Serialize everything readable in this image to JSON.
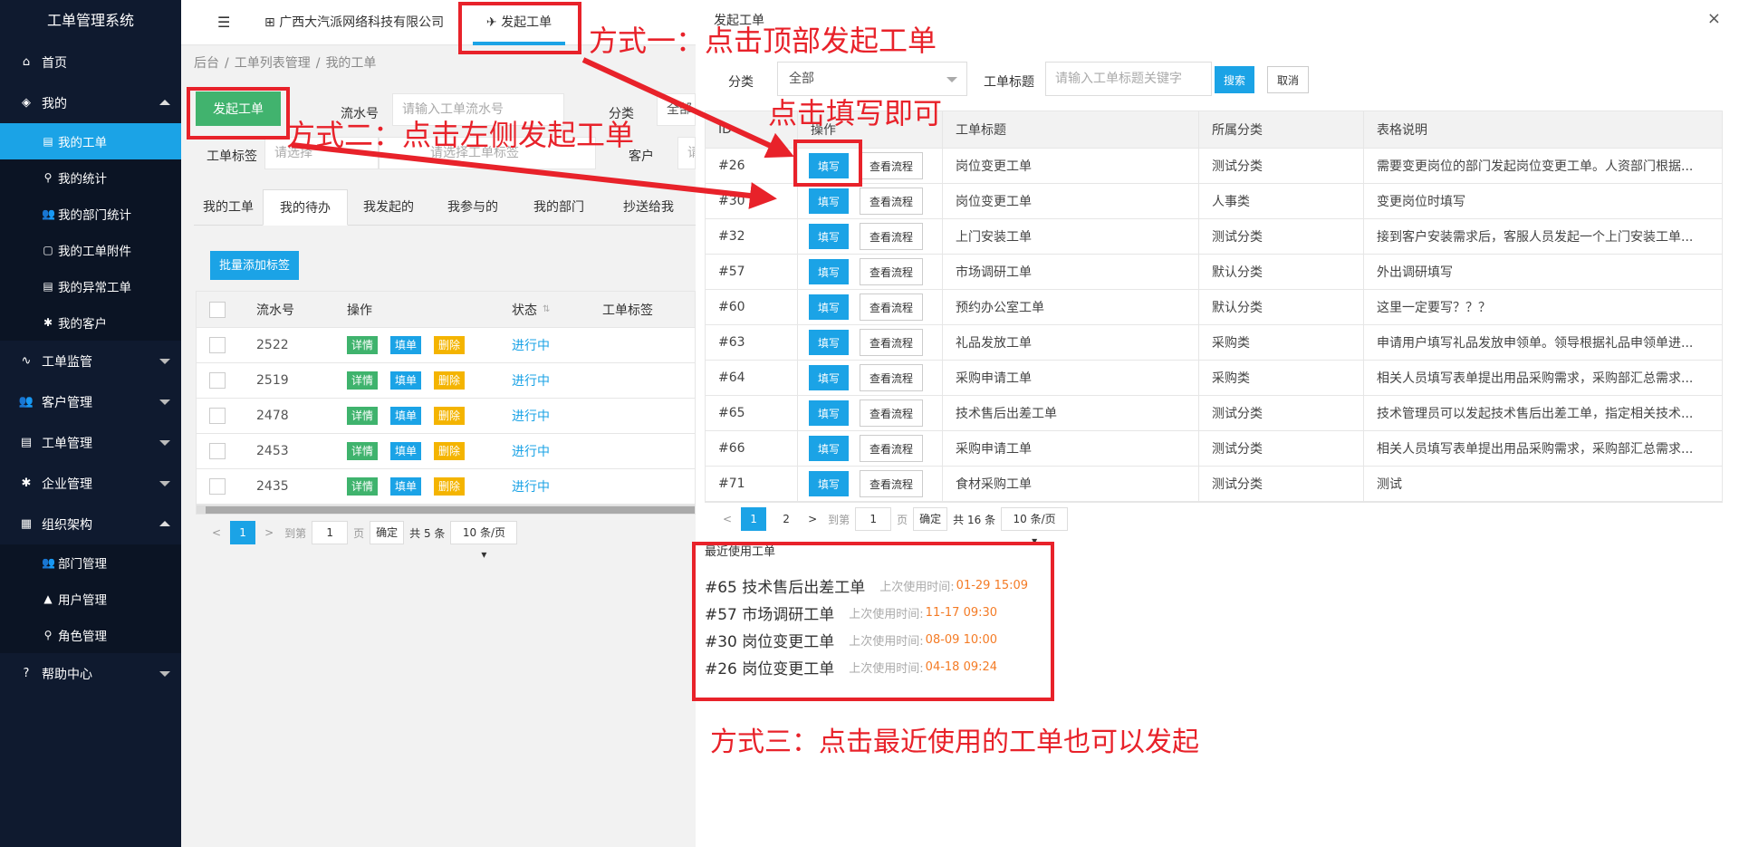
{
  "sidebar": {
    "brand": "工单管理系统",
    "items": [
      {
        "label": "首页",
        "icon": "⌂"
      },
      {
        "label": "我的",
        "icon": "◈"
      },
      {
        "label": "工单监管",
        "icon": "∿"
      },
      {
        "label": "客户管理",
        "icon": "👥"
      },
      {
        "label": "工单管理",
        "icon": "▤"
      },
      {
        "label": "企业管理",
        "icon": "✱"
      },
      {
        "label": "组织架构",
        "icon": "▦"
      },
      {
        "label": "帮助中心",
        "icon": "?"
      }
    ],
    "my_sub": [
      {
        "label": "我的工单",
        "icon": "▤"
      },
      {
        "label": "我的统计",
        "icon": "⚲"
      },
      {
        "label": "我的部门统计",
        "icon": "👥"
      },
      {
        "label": "我的工单附件",
        "icon": "▢"
      },
      {
        "label": "我的异常工单",
        "icon": "▤"
      },
      {
        "label": "我的客户",
        "icon": "✱"
      }
    ],
    "org_sub": [
      {
        "label": "部门管理",
        "icon": "👥"
      },
      {
        "label": "用户管理",
        "icon": "▲"
      },
      {
        "label": "角色管理",
        "icon": "⚲"
      }
    ]
  },
  "topbar": {
    "hamburger_icon": "☰",
    "company": "广西大汽派网络科技有限公司",
    "company_icon": "⊞",
    "launch_tab": "发起工单",
    "launch_icon": "✈"
  },
  "breadcrumb": [
    "后台",
    "工单列表管理",
    "我的工单"
  ],
  "filters": {
    "launch_button": "发起工单",
    "serial_label": "流水号",
    "serial_placeholder": "请输入工单流水号",
    "category_label": "分类",
    "category_value": "全部",
    "tag_label": "工单标签",
    "tag_placeholder": "请选择",
    "tag_placeholder2": "请选择工单标签",
    "customer_label": "客户",
    "customer_placeholder": "请"
  },
  "tabs": [
    "我的工单",
    "我的待办",
    "我发起的",
    "我参与的",
    "我的部门",
    "抄送给我"
  ],
  "batch_button": "批量添加标签",
  "grid": {
    "headers": {
      "serial": "流水号",
      "ops": "操作",
      "status": "状态",
      "tags": "工单标签"
    },
    "ops": {
      "detail": "详情",
      "fill": "填单",
      "delete": "删除"
    },
    "rows": [
      {
        "serial": "2522",
        "status": "进行中"
      },
      {
        "serial": "2519",
        "status": "进行中"
      },
      {
        "serial": "2478",
        "status": "进行中"
      },
      {
        "serial": "2453",
        "status": "进行中"
      },
      {
        "serial": "2435",
        "status": "进行中"
      }
    ]
  },
  "pager_left": {
    "prev": "<",
    "page": "1",
    "next": ">",
    "goto": "到第",
    "input": "1",
    "page_unit": "页",
    "confirm": "确定",
    "total": "共 5 条",
    "size": "10 条/页"
  },
  "modal": {
    "title": "发起工单",
    "close": "×",
    "category_label": "分类",
    "category_value": "全部",
    "title_label": "工单标题",
    "title_placeholder": "请输入工单标题关键字",
    "search": "搜索",
    "cancel": "取消",
    "headers": {
      "id": "ID",
      "op": "操作",
      "title": "工单标题",
      "cat": "所属分类",
      "desc": "表格说明"
    },
    "fill": "填写",
    "flow": "查看流程",
    "rows": [
      {
        "id": "#26",
        "title": "岗位变更工单",
        "cat": "测试分类",
        "desc": "需要变更岗位的部门发起岗位变更工单。人资部门根据..."
      },
      {
        "id": "#30",
        "title": "岗位变更工单",
        "cat": "人事类",
        "desc": "变更岗位时填写"
      },
      {
        "id": "#32",
        "title": "上门安装工单",
        "cat": "测试分类",
        "desc": "接到客户安装需求后，客服人员发起一个上门安装工单..."
      },
      {
        "id": "#57",
        "title": "市场调研工单",
        "cat": "默认分类",
        "desc": "外出调研填写"
      },
      {
        "id": "#60",
        "title": "预约办公室工单",
        "cat": "默认分类",
        "desc": "这里一定要写？？？"
      },
      {
        "id": "#63",
        "title": "礼品发放工单",
        "cat": "采购类",
        "desc": "申请用户填写礼品发放申领单。领导根据礼品申领单进..."
      },
      {
        "id": "#64",
        "title": "采购申请工单",
        "cat": "采购类",
        "desc": "相关人员填写表单提出用品采购需求，采购部汇总需求..."
      },
      {
        "id": "#65",
        "title": "技术售后出差工单",
        "cat": "测试分类",
        "desc": "技术管理员可以发起技术售后出差工单，指定相关技术..."
      },
      {
        "id": "#66",
        "title": "采购申请工单",
        "cat": "测试分类",
        "desc": "相关人员填写表单提出用品采购需求，采购部汇总需求..."
      },
      {
        "id": "#71",
        "title": "食材采购工单",
        "cat": "测试分类",
        "desc": "测试"
      }
    ],
    "pager": {
      "prev": "<",
      "p1": "1",
      "p2": "2",
      "next": ">",
      "goto": "到第",
      "input": "1",
      "page_unit": "页",
      "confirm": "确定",
      "total": "共 16 条",
      "size": "10 条/页"
    },
    "recent_title": "最近使用工单",
    "recent_label": "上次使用时间:",
    "recent": [
      {
        "name": "#65 技术售后出差工单",
        "time": "01-29 15:09"
      },
      {
        "name": "#57 市场调研工单",
        "time": "11-17 09:30"
      },
      {
        "name": "#30 岗位变更工单",
        "time": "08-09 10:00"
      },
      {
        "name": "#26 岗位变更工单",
        "time": "04-18 09:24"
      }
    ]
  },
  "annotations": {
    "method1": "方式一：点击顶部发起工单",
    "method2": "方式二：点击左侧发起工单",
    "fill_hint": "点击填写即可",
    "method3": "方式三：点击最近使用的工单也可以发起",
    "color": "#e8222a"
  },
  "colors": {
    "accent": "#1ba3e6",
    "sidebar": "#0f1a2f",
    "green": "#41b36e",
    "orange": "#f4b400",
    "time": "#f47b25"
  }
}
